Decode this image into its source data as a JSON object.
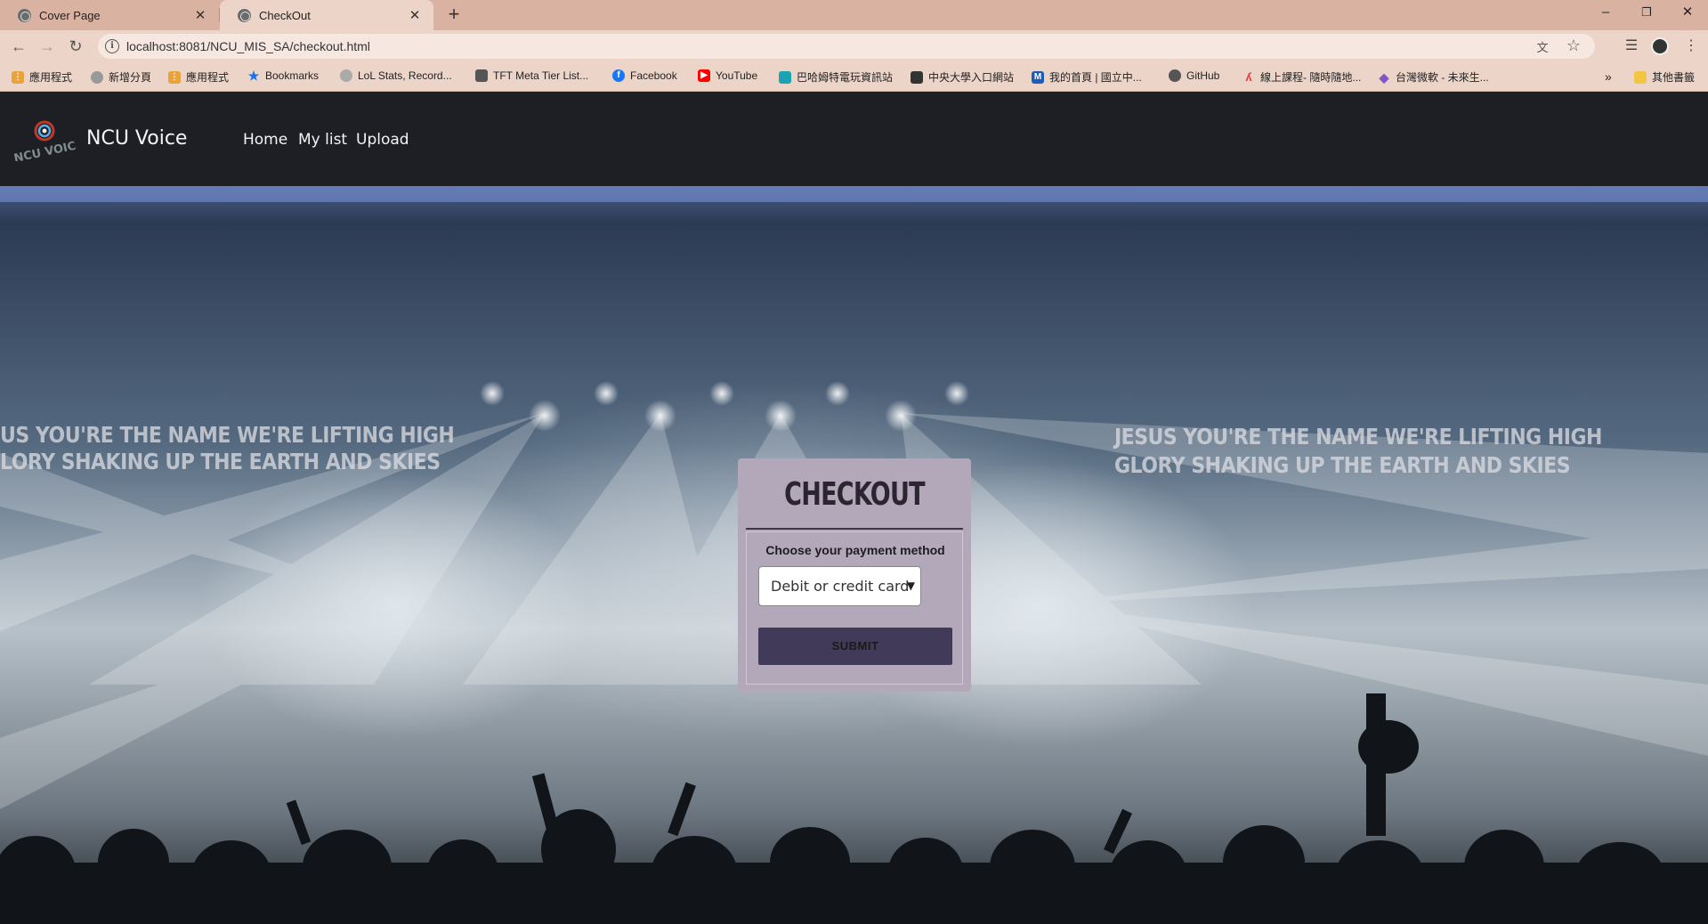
{
  "browser": {
    "tabs": [
      {
        "title": "Cover Page",
        "active": false
      },
      {
        "title": "CheckOut",
        "active": true
      }
    ],
    "url": "localhost:8081/NCU_MIS_SA/checkout.html",
    "bookmarks": [
      {
        "label": "應用程式",
        "icon": "apps-grid-icon",
        "color": "#4285f4"
      },
      {
        "label": "新增分頁",
        "icon": "globe-icon",
        "color": "#888888"
      },
      {
        "label": "應用程式",
        "icon": "apps-grid-icon",
        "color": "#4285f4"
      },
      {
        "label": "Bookmarks",
        "icon": "star-icon",
        "color": "#1a73e8"
      },
      {
        "label": "LoL Stats, Record...",
        "icon": "globe-icon",
        "color": "#888888"
      },
      {
        "label": "TFT Meta Tier List...",
        "icon": "tft-icon",
        "color": "#444444"
      },
      {
        "label": "Facebook",
        "icon": "facebook-icon",
        "color": "#1877f2"
      },
      {
        "label": "YouTube",
        "icon": "youtube-icon",
        "color": "#ff0000"
      },
      {
        "label": "巴哈姆特電玩資訊站",
        "icon": "bahamut-icon",
        "color": "#1ba3b3"
      },
      {
        "label": "中央大學入口網站",
        "icon": "ncu-icon",
        "color": "#333333"
      },
      {
        "label": "我的首頁 | 國立中...",
        "icon": "m-icon",
        "color": "#1e5bb8"
      },
      {
        "label": "GitHub",
        "icon": "github-icon",
        "color": "#555555"
      },
      {
        "label": "線上課程- 隨時隨地...",
        "icon": "course-icon",
        "color": "#e53935"
      },
      {
        "label": "台灣微軟 - 未來生...",
        "icon": "diamond-icon",
        "color": "#7e57c2"
      }
    ],
    "other_bookmarks": "其他書籤",
    "overflow": "»"
  },
  "site": {
    "brand": "NCU Voice",
    "nav": [
      "Home",
      "My list",
      "Upload"
    ]
  },
  "hero": {
    "lyrics_left": [
      "US YOU'RE THE NAME WE'RE LIFTING HIGH",
      "LORY SHAKING UP THE EARTH AND SKIES"
    ],
    "lyrics_right": [
      "JESUS YOU'RE THE NAME WE'RE LIFTING HIGH",
      "GLORY SHAKING UP THE EARTH AND SKIES"
    ]
  },
  "checkout": {
    "title": "CHECKOUT",
    "payment_label": "Choose your payment method",
    "payment_selected": "Debit or credit card",
    "submit_label": "SUBMIT"
  }
}
